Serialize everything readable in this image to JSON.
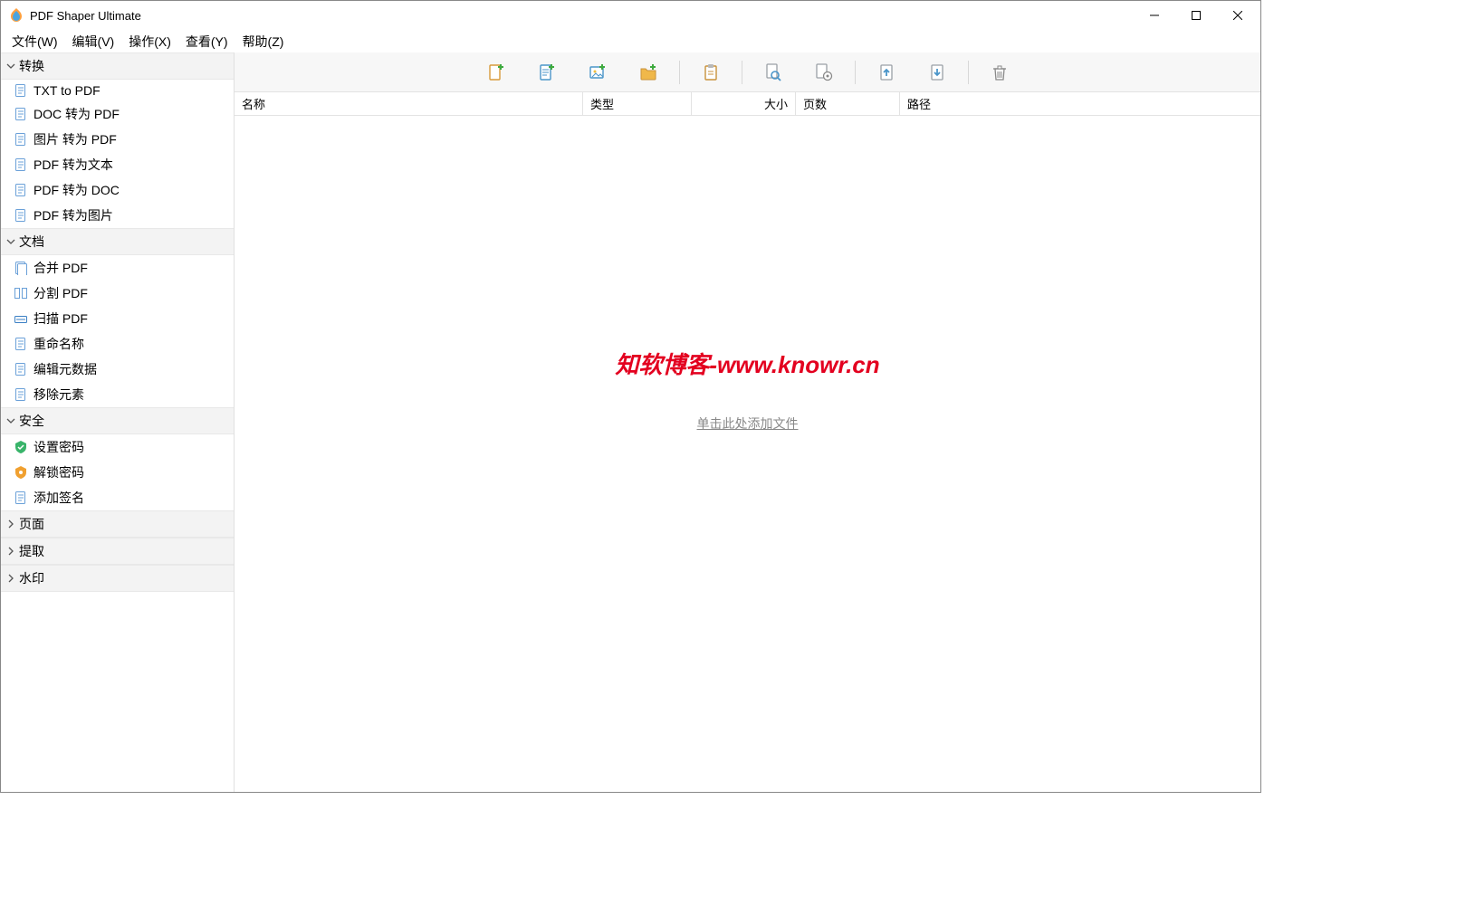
{
  "title": "PDF Shaper Ultimate",
  "menu": [
    {
      "label": "文件(W)"
    },
    {
      "label": "编辑(V)"
    },
    {
      "label": "操作(X)"
    },
    {
      "label": "查看(Y)"
    },
    {
      "label": "帮助(Z)"
    }
  ],
  "sidebar": {
    "groups": [
      {
        "label": "转换",
        "expanded": true,
        "items": [
          {
            "label": "TXT to PDF",
            "icon": "txt-pdf"
          },
          {
            "label": "DOC 转为 PDF",
            "icon": "doc-pdf"
          },
          {
            "label": "图片 转为 PDF",
            "icon": "img-pdf"
          },
          {
            "label": "PDF 转为文本",
            "icon": "pdf-txt"
          },
          {
            "label": "PDF 转为 DOC",
            "icon": "pdf-doc"
          },
          {
            "label": "PDF 转为图片",
            "icon": "pdf-img"
          }
        ]
      },
      {
        "label": "文档",
        "expanded": true,
        "items": [
          {
            "label": "合并 PDF",
            "icon": "merge"
          },
          {
            "label": "分割 PDF",
            "icon": "split"
          },
          {
            "label": "扫描 PDF",
            "icon": "scan"
          },
          {
            "label": "重命名称",
            "icon": "rename"
          },
          {
            "label": "编辑元数据",
            "icon": "metadata"
          },
          {
            "label": "移除元素",
            "icon": "remove"
          }
        ]
      },
      {
        "label": "安全",
        "expanded": true,
        "items": [
          {
            "label": "设置密码",
            "icon": "lock"
          },
          {
            "label": "解锁密码",
            "icon": "unlock"
          },
          {
            "label": "添加签名",
            "icon": "sign"
          }
        ]
      },
      {
        "label": "页面",
        "expanded": false,
        "items": []
      },
      {
        "label": "提取",
        "expanded": false,
        "items": []
      },
      {
        "label": "水印",
        "expanded": false,
        "items": []
      }
    ]
  },
  "toolbar": [
    {
      "name": "add-file",
      "icon": "file-plus"
    },
    {
      "name": "add-text",
      "icon": "text-plus"
    },
    {
      "name": "add-image",
      "icon": "image-plus"
    },
    {
      "name": "add-folder",
      "icon": "folder-plus"
    },
    {
      "sep": true
    },
    {
      "name": "clipboard",
      "icon": "clipboard"
    },
    {
      "sep": true
    },
    {
      "name": "preview",
      "icon": "preview"
    },
    {
      "name": "settings",
      "icon": "page-gear"
    },
    {
      "sep": true
    },
    {
      "name": "move-up",
      "icon": "arrow-up"
    },
    {
      "name": "move-down",
      "icon": "arrow-down"
    },
    {
      "sep": true
    },
    {
      "name": "delete",
      "icon": "trash"
    }
  ],
  "columns": {
    "name": "名称",
    "type": "类型",
    "size": "大小",
    "pages": "页数",
    "path": "路径"
  },
  "watermark_text": "知软博客-www.knowr.cn",
  "add_hint": "单击此处添加文件"
}
